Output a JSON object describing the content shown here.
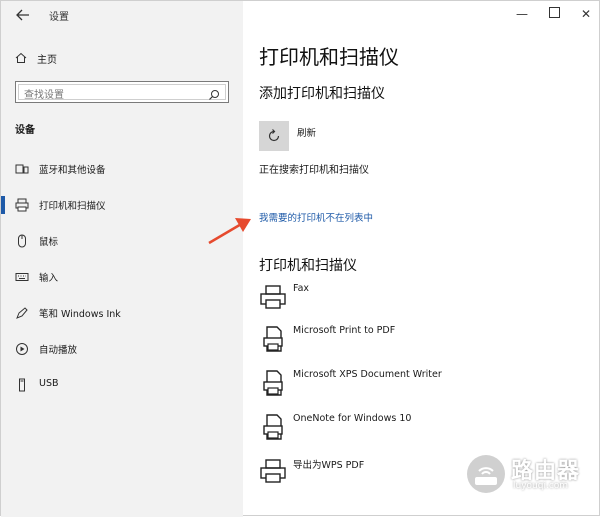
{
  "window": {
    "title": "设置",
    "controls": {
      "minimize": "—",
      "close": "✕"
    },
    "back_icon": "back-arrow-icon"
  },
  "sidebar": {
    "home": {
      "label": "主页",
      "icon": "home-icon"
    },
    "search": {
      "placeholder": "查找设置",
      "icon": "search-icon"
    },
    "section_title": "设备",
    "items": [
      {
        "label": "蓝牙和其他设备",
        "icon": "bluetooth-devices-icon",
        "active": false
      },
      {
        "label": "打印机和扫描仪",
        "icon": "printer-icon",
        "active": true
      },
      {
        "label": "鼠标",
        "icon": "mouse-icon",
        "active": false
      },
      {
        "label": "输入",
        "icon": "keyboard-icon",
        "active": false
      },
      {
        "label": "笔和 Windows Ink",
        "icon": "pen-icon",
        "active": false
      },
      {
        "label": "自动播放",
        "icon": "autoplay-icon",
        "active": false
      },
      {
        "label": "USB",
        "icon": "usb-icon",
        "active": false
      }
    ],
    "accent": "#1e5aa8"
  },
  "main": {
    "page_title": "打印机和扫描仪",
    "add_section_title": "添加打印机和扫描仪",
    "refresh_label": "刷新",
    "searching_text": "正在搜索打印机和扫描仪",
    "missing_link": "我需要的打印机不在列表中",
    "list_title": "打印机和扫描仪",
    "printers": [
      {
        "name": "Fax",
        "icon": "fax-printer-icon"
      },
      {
        "name": "Microsoft Print to PDF",
        "icon": "pdf-printer-icon"
      },
      {
        "name": "Microsoft XPS Document Writer",
        "icon": "xps-printer-icon"
      },
      {
        "name": "OneNote for Windows 10",
        "icon": "onenote-printer-icon"
      },
      {
        "name": "导出为WPS PDF",
        "icon": "wps-printer-icon"
      }
    ],
    "link_color": "#1e5aa8"
  },
  "annotation": {
    "arrow_color": "#e64a2e"
  },
  "watermark": {
    "text": "路由器",
    "subtext": "luyouqi.com",
    "icon": "router-logo-icon"
  }
}
